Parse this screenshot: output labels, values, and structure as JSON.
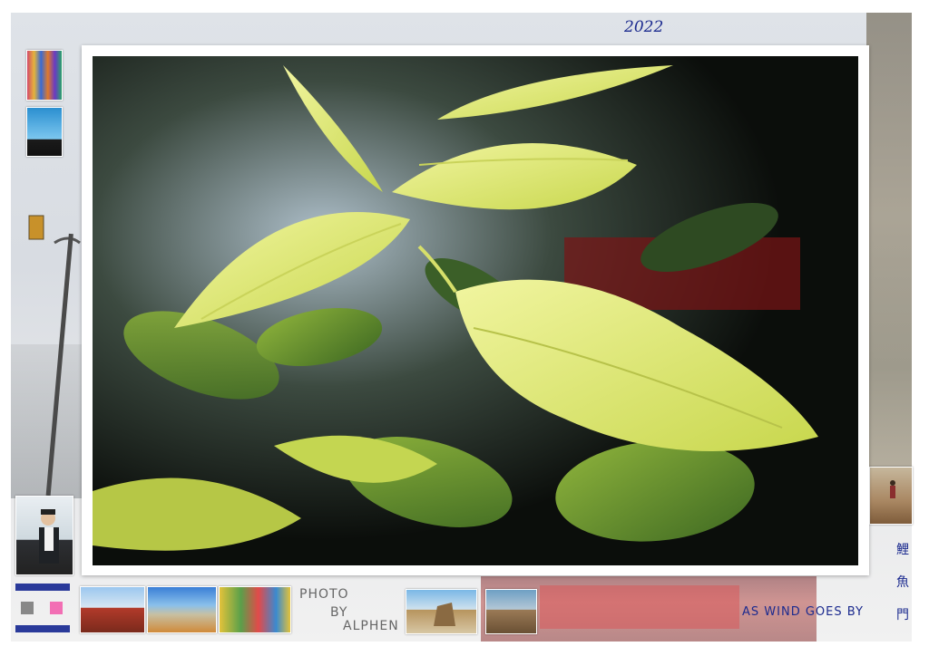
{
  "header": {
    "year": "2022"
  },
  "signature": {
    "line1": "PHOTO",
    "line2": "BY",
    "line3": "ALPHEN"
  },
  "tagline": "AS WIND GOES BY",
  "vertical_text": [
    "鯉",
    "魚",
    "門"
  ],
  "colors": {
    "accent": "#1c2b8f",
    "signature": "#666666",
    "frame": "#ffffff",
    "leaf": "#d4e36a"
  },
  "icons": [
    "flag-icon"
  ]
}
